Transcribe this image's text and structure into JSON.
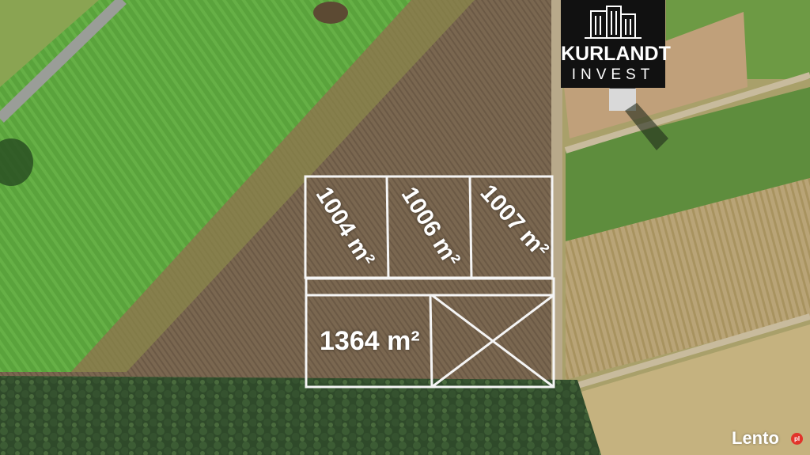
{
  "logo": {
    "line1": "KURLANDT",
    "line2": "INVEST"
  },
  "plots": [
    {
      "label": "1004 m²"
    },
    {
      "label": "1006 m²"
    },
    {
      "label": "1007 m²"
    },
    {
      "label": "1364 m²"
    }
  ],
  "watermark": {
    "text": "Lento",
    "badge": "pl"
  },
  "colors": {
    "outline": "#ffffff",
    "logo_bg": "#111111"
  }
}
